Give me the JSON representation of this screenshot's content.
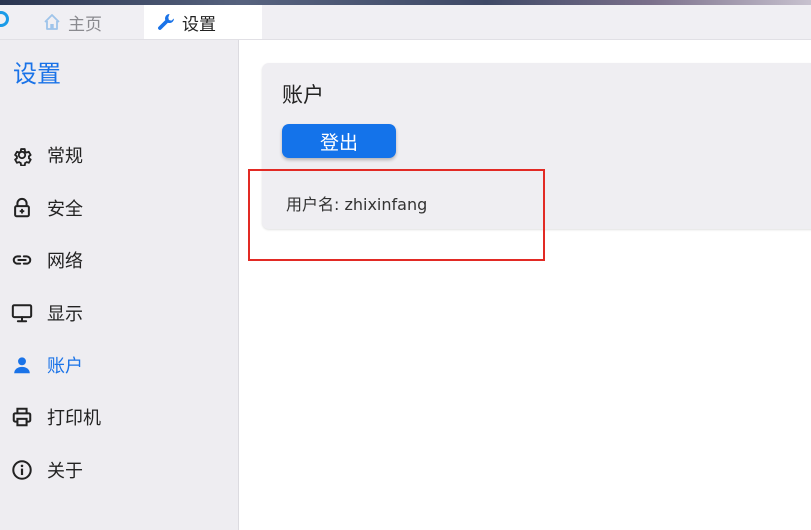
{
  "tabs": [
    {
      "label": "主页",
      "icon": "home-icon",
      "active": false
    },
    {
      "label": "设置",
      "icon": "wrench-icon",
      "active": true
    }
  ],
  "sidebar": {
    "title": "设置",
    "items": [
      {
        "label": "常规",
        "icon": "gear-icon"
      },
      {
        "label": "安全",
        "icon": "lock-icon"
      },
      {
        "label": "网络",
        "icon": "link-icon"
      },
      {
        "label": "显示",
        "icon": "monitor-icon"
      },
      {
        "label": "账户",
        "icon": "user-icon",
        "active": true
      },
      {
        "label": "打印机",
        "icon": "printer-icon"
      },
      {
        "label": "关于",
        "icon": "info-icon"
      }
    ]
  },
  "account": {
    "title": "账户",
    "logout_label": "登出",
    "username_text": "用户名: zhixinfang"
  },
  "colors": {
    "accent": "#1a73e8",
    "button": "#1473ea",
    "highlight": "#e22a24"
  }
}
